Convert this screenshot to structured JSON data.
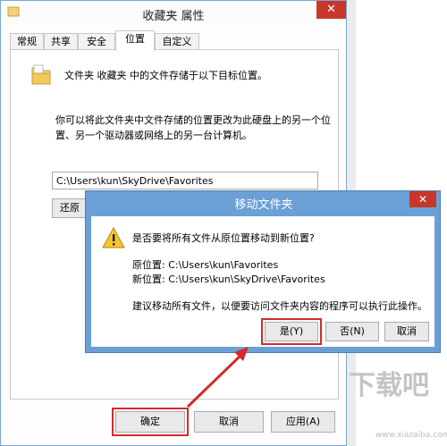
{
  "window": {
    "title": "收藏夹 属性",
    "close_glyph": "✕"
  },
  "tabs": [
    {
      "label": "常规"
    },
    {
      "label": "共享"
    },
    {
      "label": "安全"
    },
    {
      "label": "位置",
      "active": true
    },
    {
      "label": "自定义"
    }
  ],
  "panel": {
    "heading": "文件夹 收藏夹 中的文件存储于以下目标位置。",
    "description": "你可以将此文件夹中文件存储的位置更改为此硬盘上的另一个位置、另一个驱动器或网络上的另一台计算机。",
    "path_value": "C:\\Users\\kun\\SkyDrive\\Favorites",
    "restore_label": "还原"
  },
  "footer": {
    "ok_label": "确定",
    "cancel_label": "取消",
    "apply_label": "应用(A)"
  },
  "dialog": {
    "title": "移动文件夹",
    "close_glyph": "✕",
    "question": "是否要将所有文件从原位置移动到新位置?",
    "old_location": "原位置: C:\\Users\\kun\\Favorites",
    "new_location": "新位置: C:\\Users\\kun\\SkyDrive\\Favorites",
    "advice": "建议移动所有文件，以便要访问文件夹内容的程序可以执行此操作。",
    "yes_label": "是(Y)",
    "no_label": "否(N)",
    "cancel_label": "取消"
  },
  "icons": {
    "folder": "folder-icon",
    "warning": "warning-icon",
    "app": "app-icon"
  },
  "colors": {
    "highlight": "#d42a2a",
    "dialog_frame": "#6aa0d6",
    "close_red": "#c7382b"
  },
  "watermark": {
    "text": "下载吧",
    "url": "www.xiazaiba.com"
  }
}
